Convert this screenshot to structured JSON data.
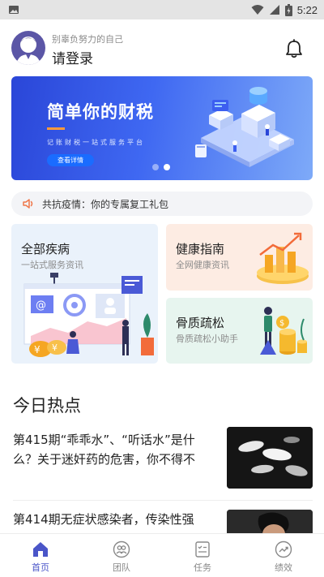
{
  "status_bar": {
    "time": "5:22"
  },
  "header": {
    "motto": "别辜负努力的自己",
    "login_label": "请登录"
  },
  "banner": {
    "title": "简单你的财税",
    "subtitle": "记账财税一站式服务平台",
    "button_label": "查看详情",
    "page_count": 2,
    "active_page": 2
  },
  "notice": {
    "text": "共抗疫情：你的专属复工礼包"
  },
  "cards": [
    {
      "title": "全部疾病",
      "subtitle": "一站式服务资讯"
    },
    {
      "title": "健康指南",
      "subtitle": "全网健康资讯"
    },
    {
      "title": "骨质疏松",
      "subtitle": "骨质疏松小助手"
    }
  ],
  "hot_section": {
    "title": "今日热点"
  },
  "news": [
    {
      "title": "第415期“乖乖水”、“听话水”是什么？关于迷奸药的危害，你不得不"
    },
    {
      "title": "第414期无症状感染者，传染性强"
    }
  ],
  "tabbar": {
    "items": [
      {
        "label": "首页",
        "icon": "home-icon",
        "active": true
      },
      {
        "label": "团队",
        "icon": "team-icon",
        "active": false
      },
      {
        "label": "任务",
        "icon": "task-icon",
        "active": false
      },
      {
        "label": "绩效",
        "icon": "performance-icon",
        "active": false
      }
    ]
  },
  "colors": {
    "accent": "#4a55c8",
    "banner": "#3f68f2",
    "notice_icon": "#f0774a"
  }
}
